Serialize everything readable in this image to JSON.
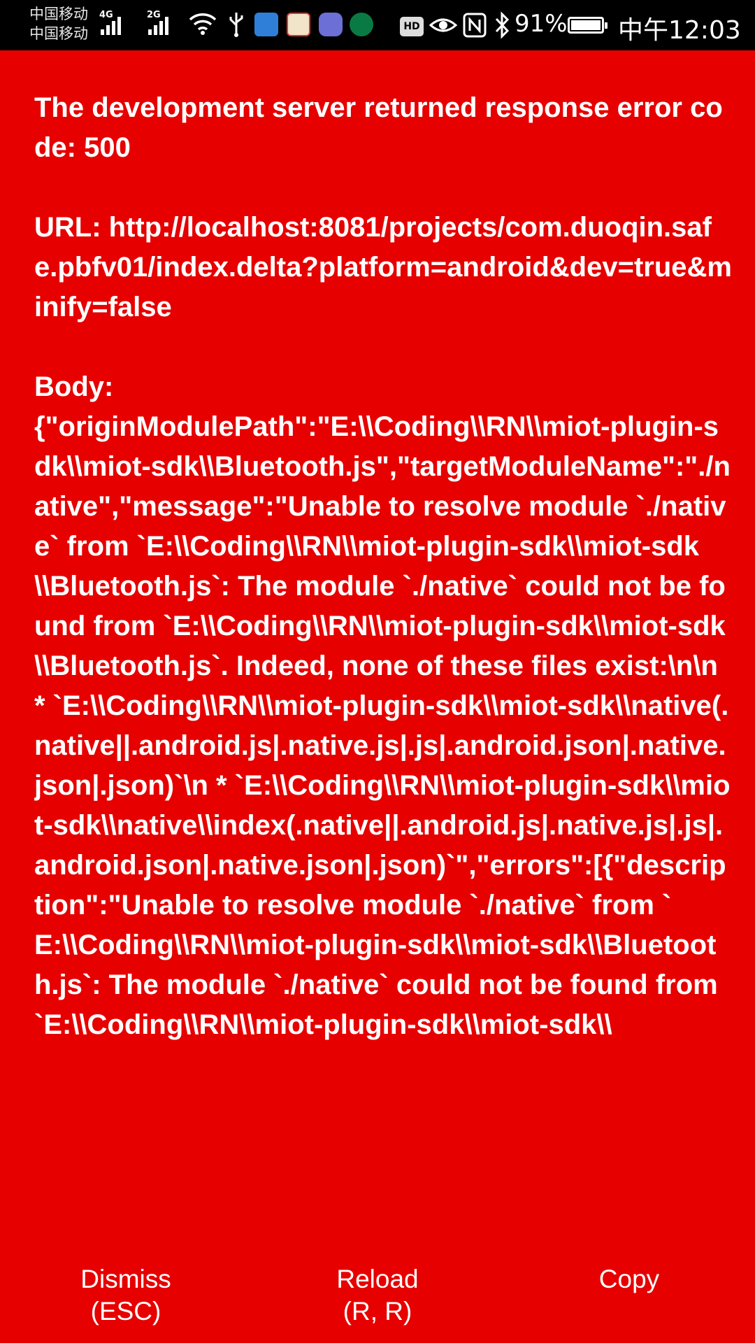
{
  "status_bar": {
    "carrier1": "中国移动",
    "carrier2": "中国移动",
    "signal1_label": "4G",
    "signal2_label": "2G",
    "hd_label": "HD",
    "battery_percent": "91%",
    "time": "中午12:03",
    "icons": [
      "wifi-icon",
      "usb-icon",
      "app-icon-blue",
      "youpin-app-icon",
      "music-app-icon",
      "starbucks-app-icon",
      "eye-icon",
      "nfc-icon",
      "bluetooth-icon",
      "battery-icon"
    ]
  },
  "error": {
    "title": "The development server returned response error code: 500",
    "url": "URL: http://localhost:8081/projects/com.duoqin.safe.pbfv01/index.delta?platform=android&dev=true&minify=false",
    "body_label": "Body:",
    "body": "{\"originModulePath\":\"E:\\\\Coding\\\\RN\\\\miot-plugin-sdk\\\\miot-sdk\\\\Bluetooth.js\",\"targetModuleName\":\"./native\",\"message\":\"Unable to resolve module `./native` from `E:\\\\Coding\\\\RN\\\\miot-plugin-sdk\\\\miot-sdk\\\\Bluetooth.js`: The module `./native` could not be found from `E:\\\\Coding\\\\RN\\\\miot-plugin-sdk\\\\miot-sdk\\\\Bluetooth.js`. Indeed, none of these files exist:\\n\\n  * `E:\\\\Coding\\\\RN\\\\miot-plugin-sdk\\\\miot-sdk\\\\native(.native||.android.js|.native.js|.js|.android.json|.native.json|.json)`\\n  * `E:\\\\Coding\\\\RN\\\\miot-plugin-sdk\\\\miot-sdk\\\\native\\\\index(.native||.android.js|.native.js|.js|.android.json|.native.json|.json)`\",\"errors\":[{\"description\":\"Unable to resolve module `./native` from `E:\\\\Coding\\\\RN\\\\miot-plugin-sdk\\\\miot-sdk\\\\Bluetooth.js`: The module `./native` could not be found from `E:\\\\Coding\\\\RN\\\\miot-plugin-sdk\\\\miot-sdk\\\\"
  },
  "buttons": {
    "dismiss_line1": "Dismiss",
    "dismiss_line2": "(ESC)",
    "reload_line1": "Reload",
    "reload_line2": "(R, R)",
    "copy_line1": "Copy"
  },
  "colors": {
    "background": "#e60000",
    "text": "#ffffff",
    "status_bar": "#000000"
  }
}
